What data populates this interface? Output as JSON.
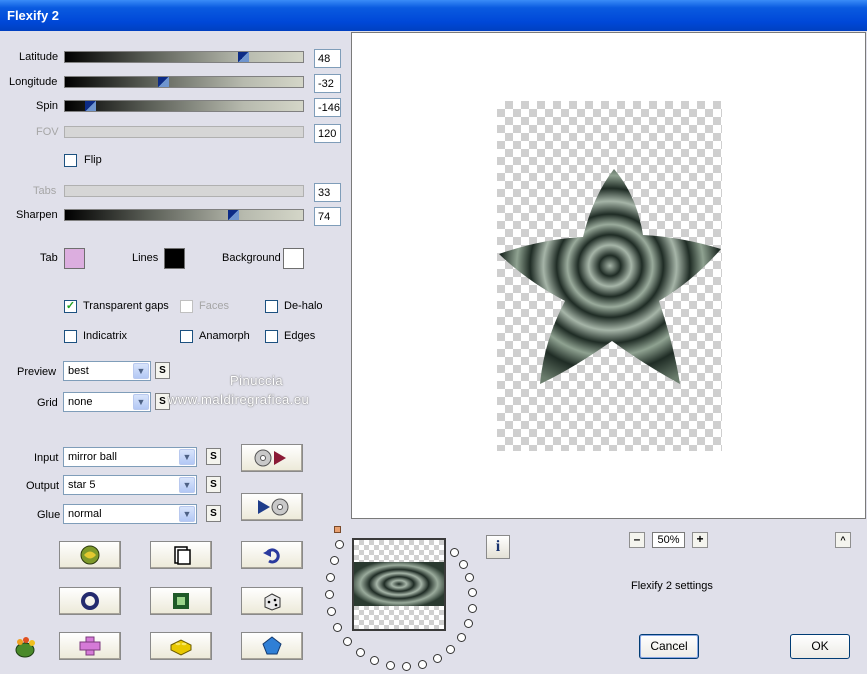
{
  "window": {
    "title": "Flexify 2"
  },
  "sliders": [
    {
      "label": "Latitude",
      "value": "48",
      "disabled": false,
      "position": 0.76
    },
    {
      "label": "Longitude",
      "value": "-32",
      "disabled": false,
      "position": 0.41
    },
    {
      "label": "Spin",
      "value": "-146",
      "disabled": false,
      "position": 0.09
    },
    {
      "label": "FOV",
      "value": "120",
      "disabled": true
    },
    {
      "label": "Tabs",
      "value": "33",
      "disabled": true
    },
    {
      "label": "Sharpen",
      "value": "74",
      "disabled": false,
      "position": 0.72
    }
  ],
  "flip": {
    "label": "Flip",
    "checked": false
  },
  "colors": {
    "tab": {
      "label": "Tab",
      "color": "#dcaedf"
    },
    "lines": {
      "label": "Lines",
      "color": "#000000"
    },
    "background": {
      "label": "Background",
      "color": "#ffffff"
    }
  },
  "options": {
    "transparent_gaps": {
      "label": "Transparent gaps",
      "checked": true
    },
    "faces": {
      "label": "Faces",
      "checked": false,
      "disabled": true
    },
    "de_halo": {
      "label": "De-halo",
      "checked": false
    },
    "indicatrix": {
      "label": "Indicatrix",
      "checked": false
    },
    "anamorph": {
      "label": "Anamorph",
      "checked": false
    },
    "edges": {
      "label": "Edges",
      "checked": false
    }
  },
  "preview_select": {
    "label": "Preview",
    "value": "best"
  },
  "grid_select": {
    "label": "Grid",
    "value": "none"
  },
  "s_label": "S",
  "input_select": {
    "label": "Input",
    "value": "mirror ball"
  },
  "output_select": {
    "label": "Output",
    "value": "star 5"
  },
  "glue_select": {
    "label": "Glue",
    "value": "normal"
  },
  "watermark": {
    "line1": "Pinuccia",
    "line2": "www.maldiregrafica.eu"
  },
  "zoom": {
    "minus": "–",
    "value": "50%",
    "plus": "+",
    "up": "^"
  },
  "settings_label": "Flexify 2 settings",
  "info_label": "i",
  "buttons": {
    "cancel": "Cancel",
    "ok": "OK"
  },
  "accent_colors": {
    "title_bar": "#0a5be0",
    "star_dark": "#1f2c25",
    "star_light": "#a6b5a8"
  }
}
